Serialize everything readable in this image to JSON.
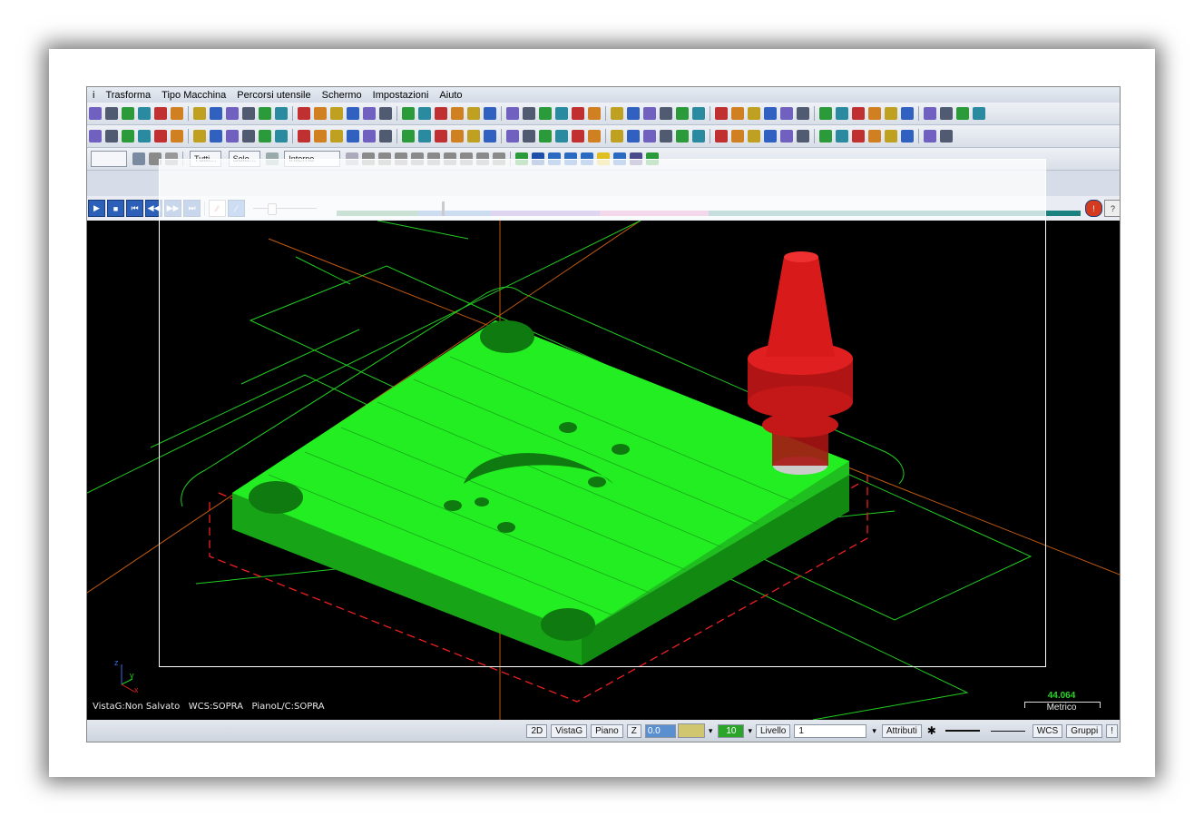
{
  "menu": {
    "items": [
      "i",
      "Trasforma",
      "Tipo Macchina",
      "Percorsi utensile",
      "Schermo",
      "Impostazioni",
      "Aiuto"
    ]
  },
  "toolbar3": {
    "filter_all": "Tutti...",
    "filter_only": "Solo...",
    "mode_select": "Interno"
  },
  "viewport": {
    "status_line": "VistaG:Non Salvato   WCS:SOPRA   PianoL/C:SOPRA",
    "scale_value": "44.064",
    "scale_unit": "Metrico",
    "axis_z": "z",
    "axis_y": "y",
    "axis_x": "x"
  },
  "statusbar": {
    "btn_2d": "2D",
    "btn_vistag": "VistaG",
    "btn_piano": "Piano",
    "label_z": "Z",
    "z_value": "0.0",
    "level_value": "10",
    "label_livello": "Livello",
    "livello_value": "1",
    "btn_attributi": "Attributi",
    "btn_wcs": "WCS",
    "btn_gruppi": "Gruppi"
  },
  "colors": {
    "part_green": "#22ff22",
    "tool_red": "#e02020",
    "background": "#000000",
    "timeline_green": "#2e8b57",
    "timeline_blue": "#3a78c8",
    "timeline_purple": "#7b5cc8",
    "timeline_pink": "#d060b0",
    "timeline_teal": "#1a8080"
  }
}
